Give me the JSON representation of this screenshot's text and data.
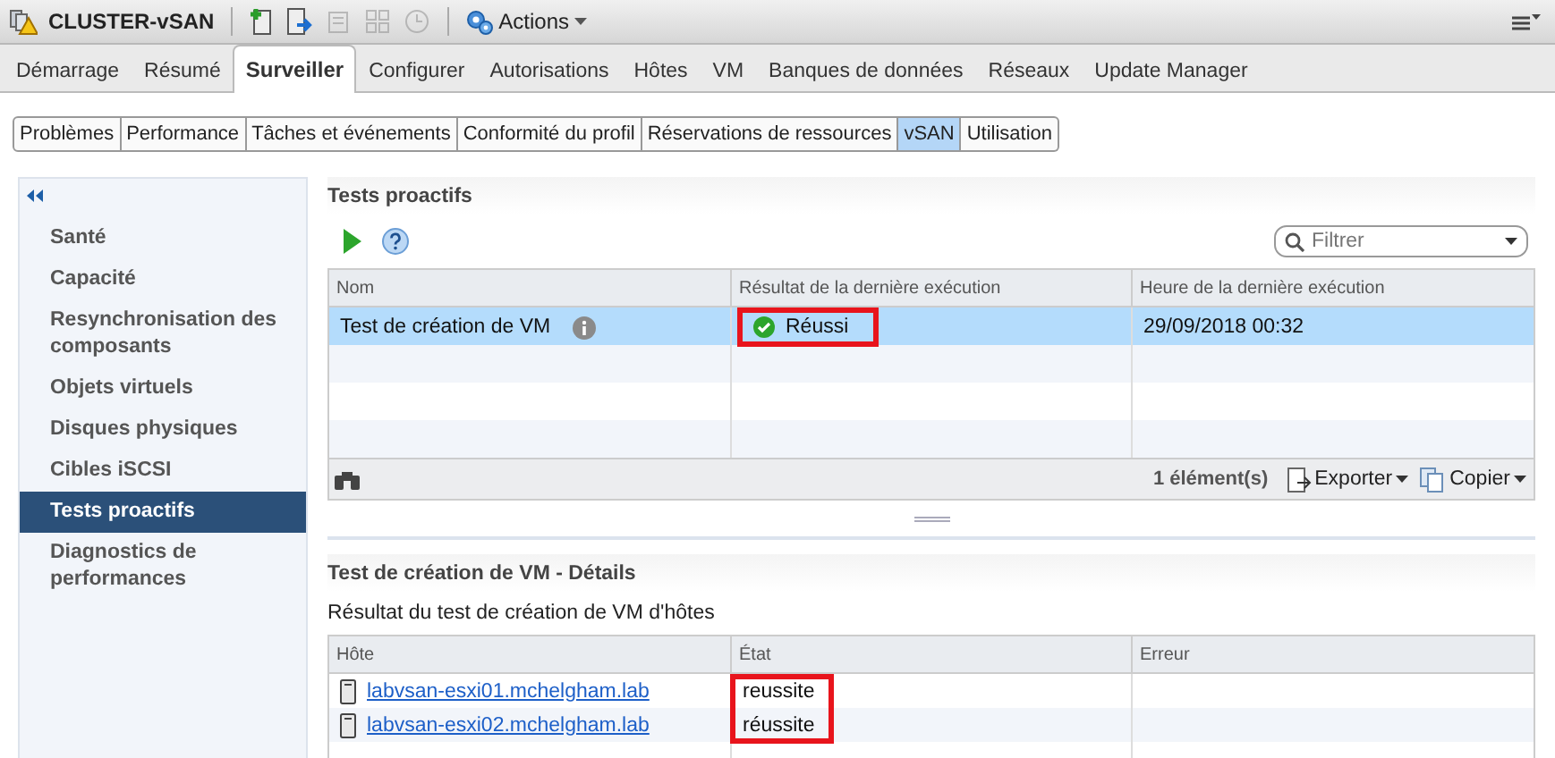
{
  "toolbar": {
    "object_name": "CLUSTER-vSAN",
    "actions_label": "Actions"
  },
  "tabs": [
    {
      "label": "Démarrage",
      "selected": false
    },
    {
      "label": "Résumé",
      "selected": false
    },
    {
      "label": "Surveiller",
      "selected": true
    },
    {
      "label": "Configurer",
      "selected": false
    },
    {
      "label": "Autorisations",
      "selected": false
    },
    {
      "label": "Hôtes",
      "selected": false
    },
    {
      "label": "VM",
      "selected": false
    },
    {
      "label": "Banques de données",
      "selected": false
    },
    {
      "label": "Réseaux",
      "selected": false
    },
    {
      "label": "Update Manager",
      "selected": false
    }
  ],
  "subtabs": [
    {
      "label": "Problèmes",
      "selected": false
    },
    {
      "label": "Performance",
      "selected": false
    },
    {
      "label": "Tâches et événements",
      "selected": false
    },
    {
      "label": "Conformité du profil",
      "selected": false
    },
    {
      "label": "Réservations de ressources",
      "selected": false
    },
    {
      "label": "vSAN",
      "selected": true
    },
    {
      "label": "Utilisation",
      "selected": false
    }
  ],
  "sidebar": {
    "items": [
      {
        "label": "Santé",
        "selected": false
      },
      {
        "label": "Capacité",
        "selected": false
      },
      {
        "label": "Resynchronisation des composants",
        "selected": false
      },
      {
        "label": "Objets virtuels",
        "selected": false
      },
      {
        "label": "Disques physiques",
        "selected": false
      },
      {
        "label": "Cibles iSCSI",
        "selected": false
      },
      {
        "label": "Tests proactifs",
        "selected": true
      },
      {
        "label": "Diagnostics de performances",
        "selected": false
      }
    ]
  },
  "tests": {
    "title": "Tests proactifs",
    "filter": {
      "placeholder": "Filtrer"
    },
    "columns": [
      "Nom",
      "Résultat de la dernière exécution",
      "Heure de la dernière exécution"
    ],
    "rows": [
      {
        "name": "Test de création de VM",
        "result": "Réussi",
        "time": "29/09/2018 00:32",
        "selected": true,
        "highlighted": true
      }
    ],
    "count": "1 élément(s)",
    "export_label": "Exporter",
    "copy_label": "Copier"
  },
  "details": {
    "title": "Test de création de VM - Détails",
    "subtitle": "Résultat du test de création de VM d'hôtes",
    "columns": [
      "Hôte",
      "État",
      "Erreur"
    ],
    "rows": [
      {
        "host": "labvsan-esxi01.mchelgham.lab",
        "state": "reussite"
      },
      {
        "host": "labvsan-esxi02.mchelgham.lab",
        "state": "réussite"
      }
    ],
    "state_highlighted": true
  }
}
